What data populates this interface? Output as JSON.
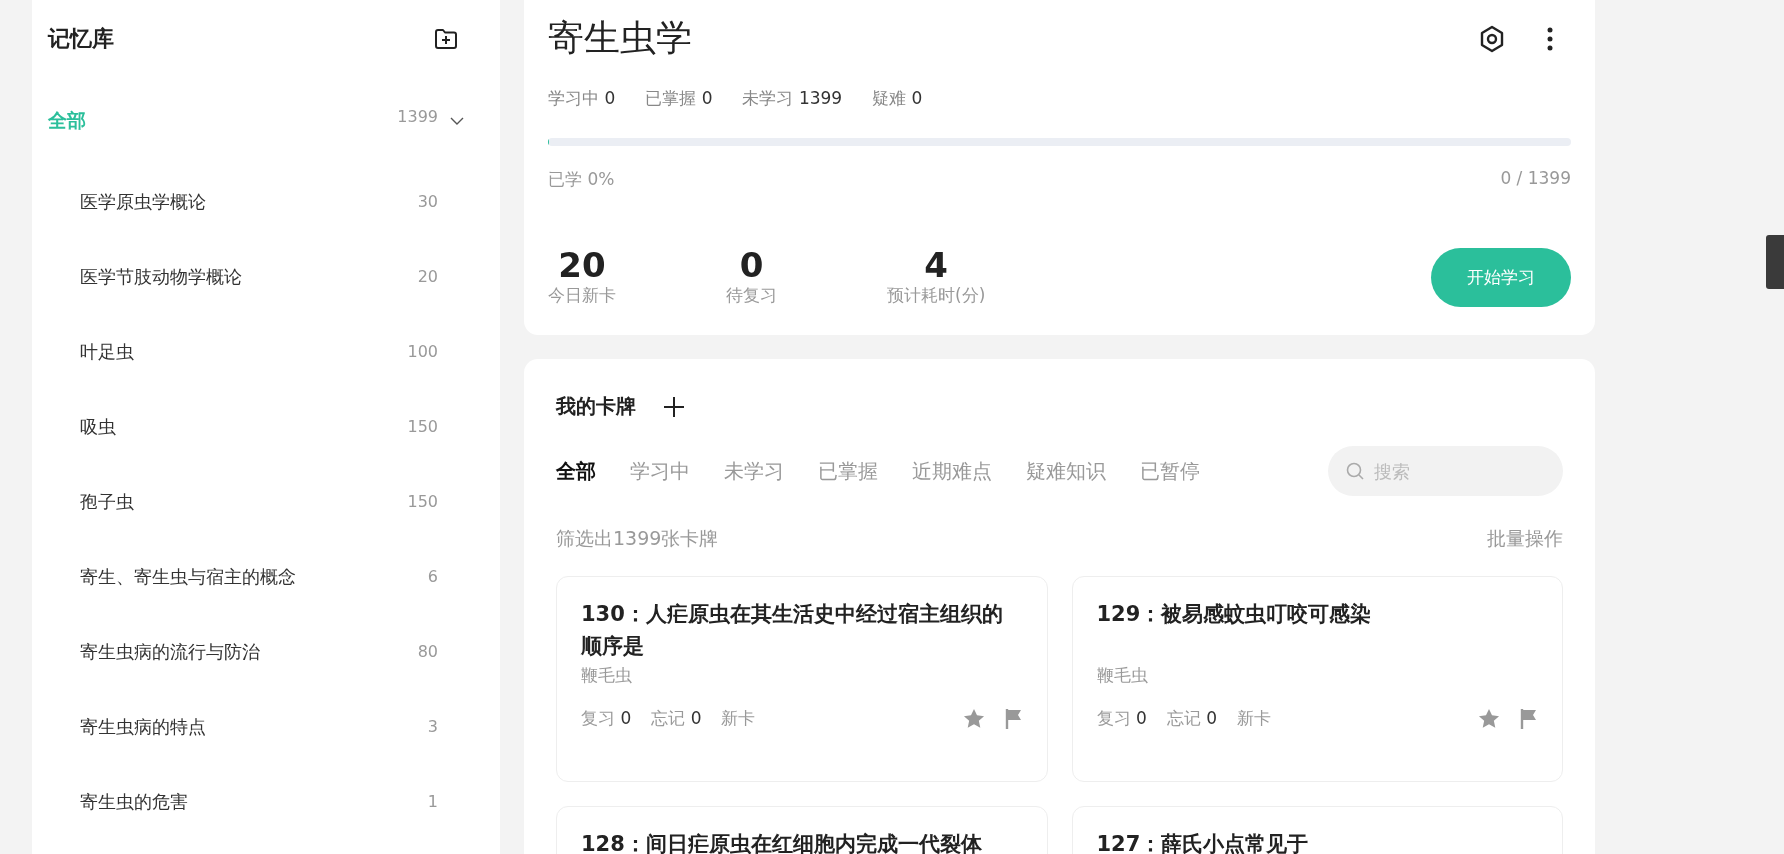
{
  "sidebar": {
    "title": "记忆库",
    "root": {
      "label": "全部",
      "count": "1399",
      "selected": true,
      "expanded": true,
      "children": [
        {
          "label": "医学原虫学概论",
          "count": "30",
          "selected": false
        },
        {
          "label": "医学节肢动物学概论",
          "count": "20",
          "selected": false
        },
        {
          "label": "叶足虫",
          "count": "100",
          "selected": false
        },
        {
          "label": "吸虫",
          "count": "150",
          "selected": false
        },
        {
          "label": "孢子虫",
          "count": "150",
          "selected": false
        },
        {
          "label": "寄生、寄生虫与宿主的概念",
          "count": "6",
          "selected": false
        },
        {
          "label": "寄生虫病的流行与防治",
          "count": "80",
          "selected": false
        },
        {
          "label": "寄生虫病的特点",
          "count": "3",
          "selected": false
        },
        {
          "label": "寄生虫的危害",
          "count": "1",
          "selected": false
        }
      ]
    }
  },
  "deck": {
    "title": "寄生虫学",
    "stats": [
      {
        "label": "学习中",
        "value": "0"
      },
      {
        "label": "已掌握",
        "value": "0"
      },
      {
        "label": "未学习",
        "value": "1399"
      },
      {
        "label": "疑难",
        "value": "0"
      }
    ],
    "progress": {
      "level": 0,
      "label": "已学 0%",
      "reading": "0 / 1399"
    },
    "summary": [
      {
        "value": "20",
        "label": "今日新卡"
      },
      {
        "value": "0",
        "label": "待复习"
      },
      {
        "value": "4",
        "label": "预计耗时(分)"
      }
    ],
    "start_button": "开始学习"
  },
  "cards": {
    "title": "我的卡牌",
    "tabs": [
      {
        "label": "全部",
        "selected": true
      },
      {
        "label": "学习中",
        "selected": false
      },
      {
        "label": "未学习",
        "selected": false
      },
      {
        "label": "已掌握",
        "selected": false
      },
      {
        "label": "近期难点",
        "selected": false
      },
      {
        "label": "疑难知识",
        "selected": false
      },
      {
        "label": "已暂停",
        "selected": false
      }
    ],
    "search": {
      "placeholder": "搜索"
    },
    "filter_summary": "筛选出1399张卡牌",
    "bulk_action": "批量操作",
    "items": [
      {
        "title": "130：人疟原虫在其生活史中经过宿主组织的顺序是",
        "tag": "鞭毛虫",
        "review_label": "复习",
        "review": "0",
        "forget_label": "忘记",
        "forget": "0",
        "status": "新卡"
      },
      {
        "title": "129：被易感蚊虫叮咬可感染",
        "tag": "鞭毛虫",
        "review_label": "复习",
        "review": "0",
        "forget_label": "忘记",
        "forget": "0",
        "status": "新卡"
      },
      {
        "title": "128：间日疟原虫在红细胞内完成一代裂体"
      },
      {
        "title": "127：薛氏小点常见于"
      }
    ]
  }
}
